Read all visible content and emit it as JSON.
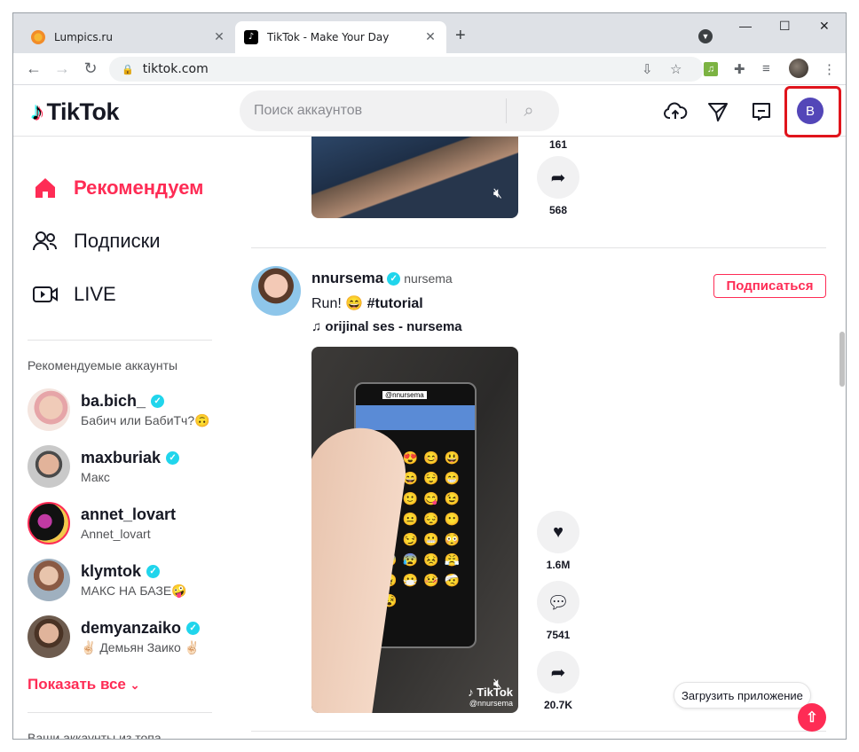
{
  "browser": {
    "tabs": [
      {
        "title": "Lumpics.ru",
        "active": false
      },
      {
        "title": "TikTok - Make Your Day",
        "active": true
      }
    ],
    "url": "tiktok.com"
  },
  "header": {
    "logo_text": "TikTok",
    "search_placeholder": "Поиск аккаунтов",
    "avatar_letter": "B",
    "colors": {
      "brand": "#fe2c55",
      "avatar_bg": "#5346b8",
      "highlight": "#e0141c"
    }
  },
  "sidebar": {
    "nav": [
      {
        "label": "Рекомендуем",
        "icon": "home-icon",
        "active": true
      },
      {
        "label": "Подписки",
        "icon": "users-icon",
        "active": false
      },
      {
        "label": "LIVE",
        "icon": "live-icon",
        "active": false
      }
    ],
    "suggested_title": "Рекомендуемые аккаунты",
    "accounts": [
      {
        "username": "ba.bich_",
        "nickname": "Бабич или БабиТч?🙃"
      },
      {
        "username": "maxburiak",
        "nickname": "Макс"
      },
      {
        "username": "annet_lovart",
        "nickname": "Annet_lovart"
      },
      {
        "username": "klymtok",
        "nickname": "МАКС НА БАЗЕ🤪"
      },
      {
        "username": "demyanzaiko",
        "nickname": "✌🏻 Демьян Заико ✌🏻"
      }
    ],
    "show_all": "Показать все",
    "top_accounts_title": "Ваши аккаунты из топа"
  },
  "feed": {
    "prev_post": {
      "count_top": "161",
      "shares": "568"
    },
    "post": {
      "username": "nnursema",
      "nickname": "nursema",
      "caption_text": "Run! 😄 ",
      "caption_tag": "#tutorial",
      "music": "♫ orijinal ses - nursema",
      "follow_label": "Подписаться",
      "likes": "1.6M",
      "comments": "7541",
      "shares": "20.7K",
      "watermark_user": "@nnursema",
      "screen_tag": "@nnursema"
    },
    "get_app_label": "Загрузить приложение"
  }
}
